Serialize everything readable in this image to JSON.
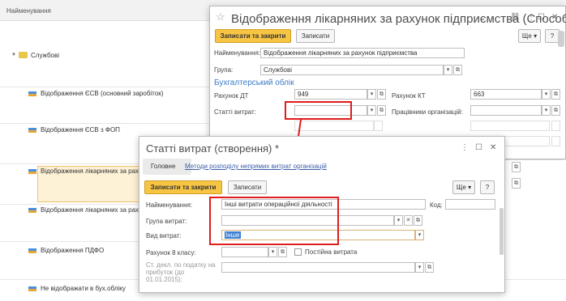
{
  "bg": {
    "column_header": "Найменування",
    "group": "Службові",
    "items": [
      "Відображення ЄСВ (основний заробіток)",
      "Відображення ЄСВ з ФОП",
      "Відображення лікарняних за рахун",
      "Відображення лікарняних за рахун",
      "Відображення ПДФО",
      "Не відображати в бух.обліку"
    ]
  },
  "main": {
    "title": "Відображення лікарняних за рахунок підприємства (Способ...",
    "save_close": "Записати та закрити",
    "save": "Записати",
    "more": "Ще",
    "help": "?",
    "name_label": "Найменування:",
    "name_value": "Відображення лікарняних за рахунок підприємства",
    "group_label": "Група:",
    "group_value": "Службові",
    "section": "Бухгалтерський облік",
    "dt_label": "Рахунок ДТ",
    "dt_value": "949",
    "kt_label": "Рахунок КТ",
    "kt_value": "663",
    "cost_label": "Статті витрат:",
    "workers_label": "Працівники організацій:"
  },
  "dialog": {
    "title": "Статті витрат (створення) *",
    "tab_main": "Головне",
    "tab_link": "Методи розподілу непрямих витрат організацій",
    "save_close": "Записати та закрити",
    "save": "Записати",
    "more": "Ще",
    "help": "?",
    "name_label": "Найменування:",
    "name_value": "Інші витрати операційної діяльності",
    "code_label": "Код:",
    "group_label": "Група витрат:",
    "kind_label": "Вид витрат:",
    "kind_value": "Інше",
    "account_label": "Рахунок 8 класу:",
    "permanent_label": "Постійна витрата",
    "decl_label": "Ст. декл. по податку на прибуток (до 01.01.2015):"
  }
}
